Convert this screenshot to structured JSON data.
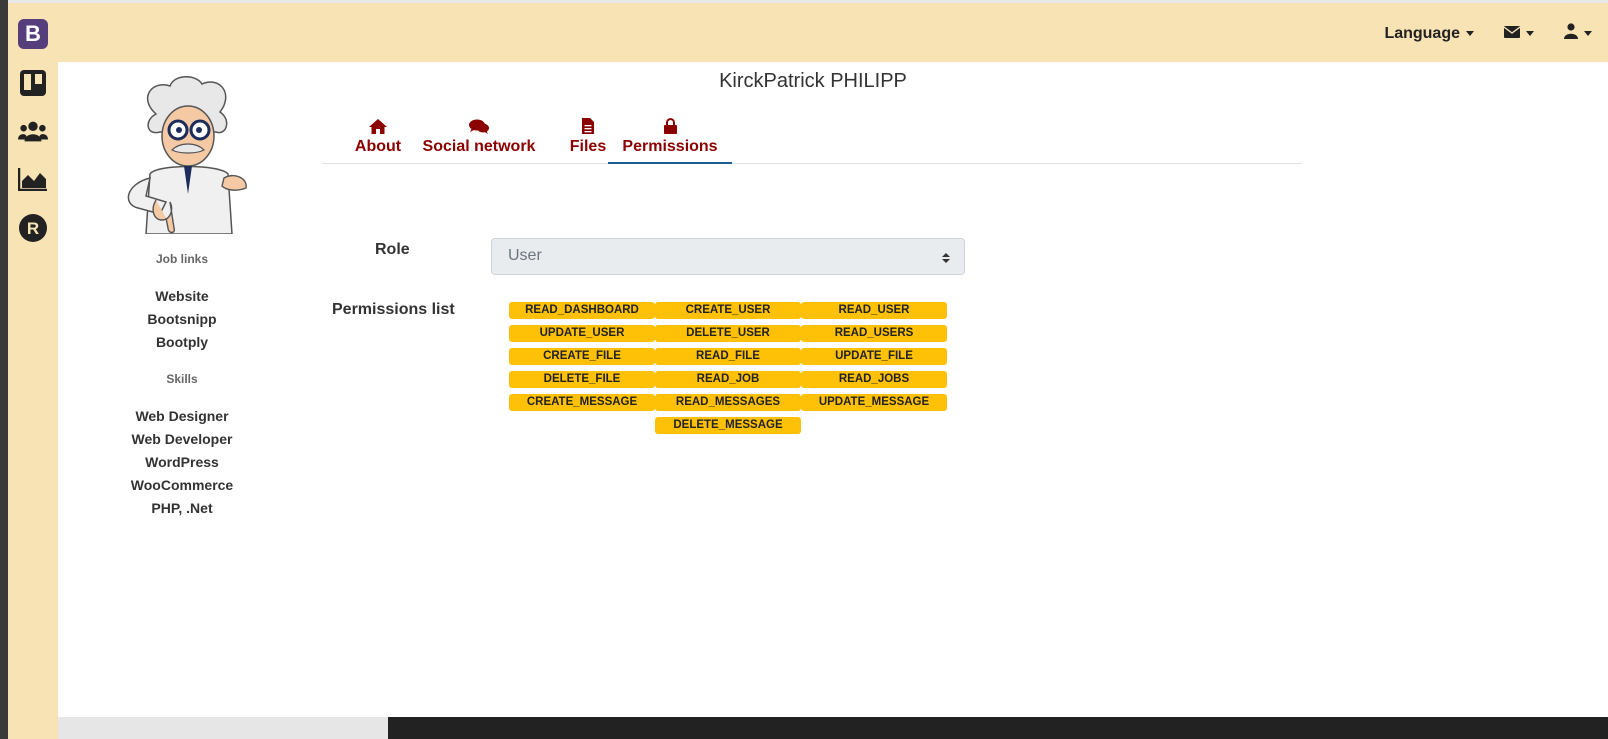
{
  "topbar": {
    "brand": "B",
    "language": "Language"
  },
  "sidebar_icons": [
    "trello-icon",
    "users-icon",
    "area-chart-icon",
    "r-badge-icon"
  ],
  "profile": {
    "name": "KirckPatrick PHILIPP",
    "job_links_title": "Job links",
    "job_links": [
      "Website",
      "Bootsnipp",
      "Bootply"
    ],
    "skills_title": "Skills",
    "skills": [
      "Web Designer",
      "Web Developer",
      "WordPress",
      "WooCommerce",
      "PHP, .Net"
    ]
  },
  "tabs": [
    {
      "label": "About",
      "icon": "home-icon"
    },
    {
      "label": "Social network",
      "icon": "comments-icon"
    },
    {
      "label": "Files",
      "icon": "file-icon"
    },
    {
      "label": "Permissions",
      "icon": "lock-icon",
      "active": true
    }
  ],
  "role": {
    "label": "Role",
    "value": "User"
  },
  "permissions": {
    "label": "Permissions list",
    "items": [
      "READ_DASHBOARD",
      "CREATE_USER",
      "READ_USER",
      "UPDATE_USER",
      "DELETE_USER",
      "READ_USERS",
      "CREATE_FILE",
      "READ_FILE",
      "UPDATE_FILE",
      "DELETE_FILE",
      "READ_JOB",
      "READ_JOBS",
      "CREATE_MESSAGE",
      "READ_MESSAGES",
      "UPDATE_MESSAGE",
      "DELETE_MESSAGE"
    ]
  },
  "colors": {
    "topbar_bg": "#f7e3b3",
    "tab_text": "#8b0000",
    "badge_bg": "#ffc107",
    "active_tab_border": "#1c5c8f"
  }
}
